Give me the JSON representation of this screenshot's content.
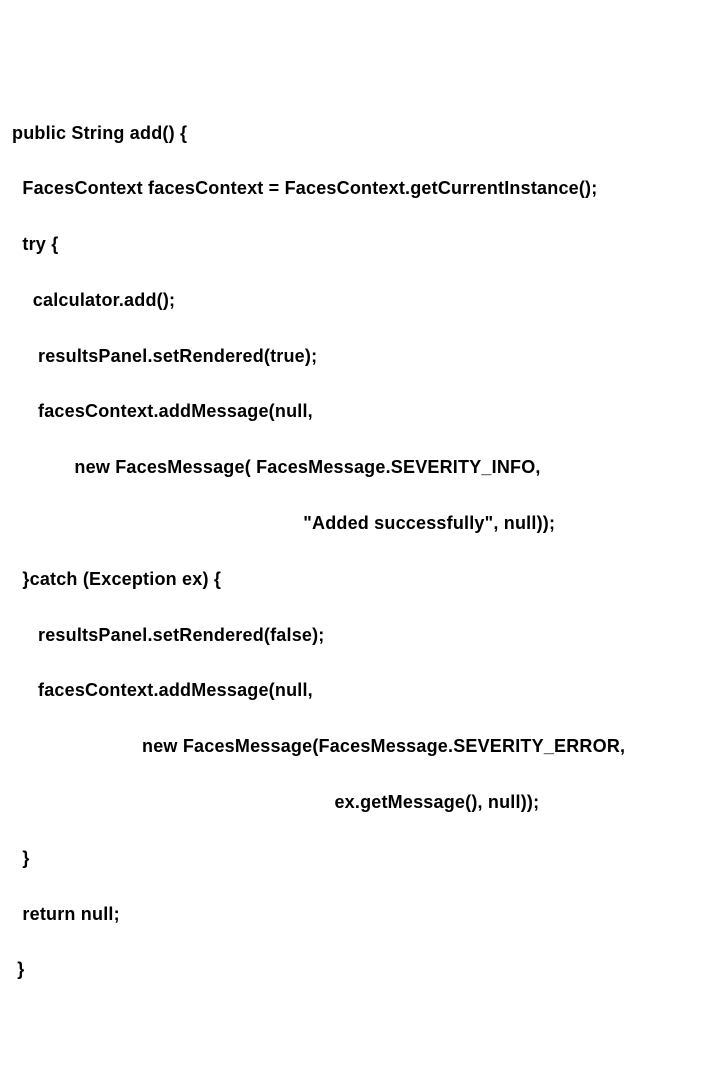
{
  "code": {
    "l1": "public String add() {",
    "l2": "  FacesContext facesContext = FacesContext.getCurrentInstance();",
    "l3": "  try {",
    "l4": "    calculator.add();",
    "l5": "     resultsPanel.setRendered(true);",
    "l6": "     facesContext.addMessage(null,",
    "l7": "            new FacesMessage( FacesMessage.SEVERITY_INFO,",
    "l8": "                                                        \"Added successfully\", null));",
    "l9": "  }catch (Exception ex) {",
    "l10": "     resultsPanel.setRendered(false);",
    "l11": "     facesContext.addMessage(null,",
    "l12": "                         new FacesMessage(FacesMessage.SEVERITY_ERROR,",
    "l13": "                                                              ex.getMessage(), null));",
    "l14": "  }",
    "l15": "  return null;",
    "l16": " }"
  }
}
